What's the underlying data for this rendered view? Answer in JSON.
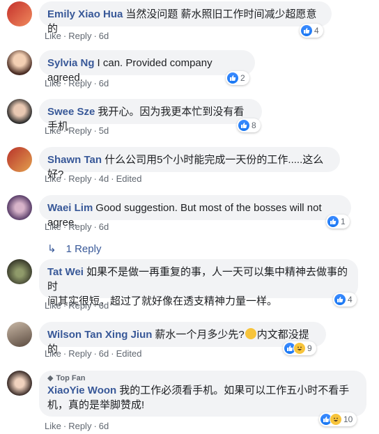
{
  "colors": {
    "link": "#385898",
    "bubble": "#f2f3f5",
    "meta": "#606770",
    "like_blue": "#1877f2"
  },
  "comments": [
    {
      "author": "Emily Xiao Hua",
      "text": "当然没问题 薪水照旧工作时间减少超愿意的",
      "like": "Like",
      "reply": "Reply",
      "time": "6d",
      "edited": "",
      "reaction_count": "4",
      "reactions": [
        "like-icon"
      ]
    },
    {
      "author": "Sylvia Ng",
      "text": "I can. Provided company agreed.",
      "like": "Like",
      "reply": "Reply",
      "time": "6d",
      "edited": "",
      "reaction_count": "2",
      "reactions": [
        "like-icon"
      ]
    },
    {
      "author": "Swee Sze",
      "text": "我开心。因为我更本忙到没有看手机",
      "like": "Like",
      "reply": "Reply",
      "time": "5d",
      "edited": "",
      "reaction_count": "8",
      "reactions": [
        "like-icon"
      ]
    },
    {
      "author": "Shawn Tan",
      "text": "什么公司用5个小时能完成一天份的工作.....这么好?",
      "like": "Like",
      "reply": "Reply",
      "time": "4d",
      "edited": "Edited",
      "reaction_count": "",
      "reactions": []
    },
    {
      "author": "Waei Lim",
      "text": "Good suggestion. But most of the bosses will not agree.",
      "like": "Like",
      "reply": "Reply",
      "time": "6d",
      "edited": "",
      "reaction_count": "1",
      "reactions": [
        "like-icon"
      ]
    },
    {
      "author": "Tat Wei",
      "text_line1": "如果不是做一再重复的事，人一天可以集中精神去做事的时",
      "text_line2": "间其实很短，超过了就好像在透支精神力量一样。",
      "like": "Like",
      "reply": "Reply",
      "time": "6d",
      "edited": "",
      "reaction_count": "4",
      "reactions": [
        "like-icon"
      ]
    },
    {
      "author": "Wilson Tan Xing Jiun",
      "text_before": "薪水一个月多少先?",
      "text_after": "内文都没提的",
      "like": "Like",
      "reply": "Reply",
      "time": "6d",
      "edited": "Edited",
      "reaction_count": "9",
      "reactions": [
        "like-icon",
        "haha-icon"
      ]
    },
    {
      "author": "XiaoYie Woon",
      "badge": "Top Fan",
      "text_line1": "我的工作必须看手机。如果可以工作五小时不看手",
      "text_line2": "机，真的是举脚赞成!",
      "like": "Like",
      "reply": "Reply",
      "time": "6d",
      "edited": "",
      "reaction_count": "10",
      "reactions": [
        "like-icon",
        "haha-icon"
      ]
    }
  ],
  "replies_link": "1 Reply"
}
